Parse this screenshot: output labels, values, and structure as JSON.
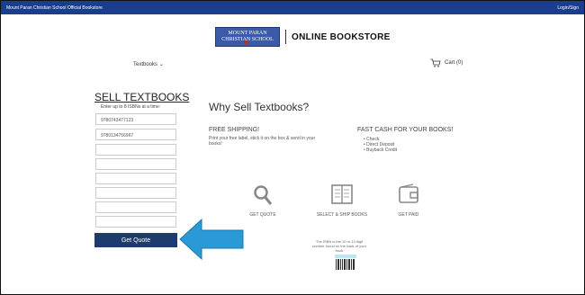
{
  "topbar": {
    "left_text": "Mount Paran Christian School Official Bookstore",
    "right_text": "Login/Sign"
  },
  "header": {
    "logo_line1": "MOUNT PARAN",
    "logo_line2": "CHRISTIAN SCHOOL",
    "logo_suffix": "ONLINE BOOKSTORE"
  },
  "nav": {
    "textbooks_label": "Textbooks",
    "cart_label": "Cart (0)"
  },
  "sell": {
    "title": "SELL TEXTBOOKS",
    "subtitle": "Enter up to 8 ISBNs at a time:",
    "isbns": [
      "9780743477123",
      "9780134756967",
      "",
      "",
      "",
      "",
      "",
      ""
    ],
    "button_label": "Get Quote"
  },
  "why": {
    "title": "Why Sell Textbooks?",
    "free_title": "FREE SHIPPING!",
    "free_body": "Print your free label, stick it on the box & send in your books!",
    "fast_title": "FAST CASH FOR YOUR BOOKS!",
    "fast_items": [
      "Check",
      "Direct Deposit",
      "Buyback Credit"
    ]
  },
  "steps": [
    {
      "label": "GET QUOTE",
      "icon": "magnifier-icon"
    },
    {
      "label": "SELECT & SHIP BOOKS",
      "icon": "book-icon"
    },
    {
      "label": "GET PAID",
      "icon": "wallet-icon"
    }
  ],
  "isbn_note": "The ISBN is the 10 or 13 digit number found on the back of your book",
  "colors": {
    "topbar": "#1a3e8c",
    "button": "#1d3b6e",
    "arrow": "#2a9ad6"
  }
}
